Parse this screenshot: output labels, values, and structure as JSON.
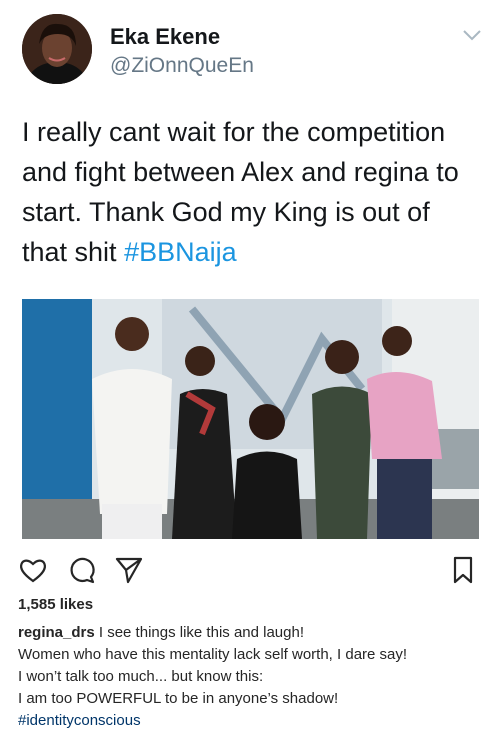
{
  "tweet": {
    "display_name": "Eka Ekene",
    "handle": "@ZiOnnQueEn",
    "text_lines": [
      "I really cant wait for the competition",
      "and fight between Alex and regina to",
      "start. Thank God my King is out of",
      "that shit"
    ],
    "hashtag": "#BBNaija",
    "icons": {
      "avatar": "profile-photo",
      "menu": "chevron-down-icon"
    }
  },
  "instagram": {
    "icons": [
      "heart-icon",
      "comment-icon",
      "share-icon",
      "bookmark-icon"
    ],
    "likes": "1,585 likes",
    "caption": {
      "username": "regina_drs",
      "first_line": "I see things like this and laugh!",
      "lines": [
        "Women who have this mentality lack self worth, I dare say!",
        "I won’t talk too much... but know this:",
        "I am too POWERFUL to be in anyone’s shadow!"
      ],
      "hashtag": "#identityconscious"
    }
  },
  "colors": {
    "link_blue": "#1b95e0",
    "ig_tag": "#003569",
    "secondary": "#657786"
  }
}
